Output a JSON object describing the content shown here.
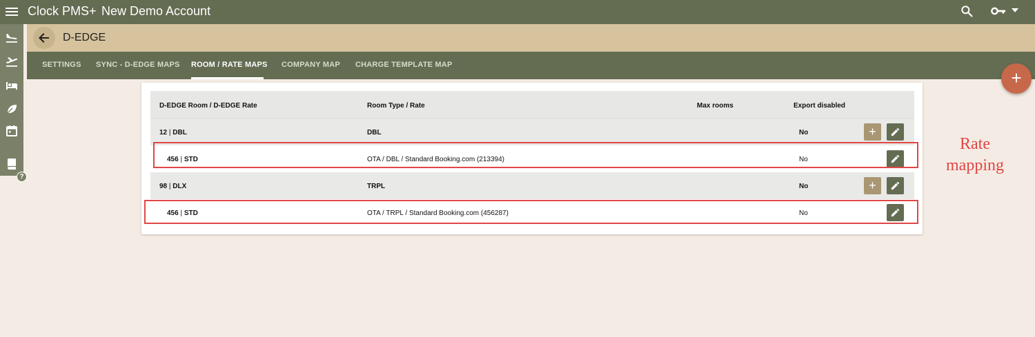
{
  "app": {
    "name": "Clock PMS+",
    "account": "New Demo Account"
  },
  "page": {
    "title": "D-EDGE"
  },
  "tabs": [
    {
      "label": "SETTINGS",
      "active": false
    },
    {
      "label": "SYNC - D-EDGE MAPS",
      "active": false
    },
    {
      "label": "ROOM / RATE MAPS",
      "active": true
    },
    {
      "label": "COMPANY MAP",
      "active": false
    },
    {
      "label": "CHARGE TEMPLATE MAP",
      "active": false
    }
  ],
  "table": {
    "columns": [
      "D-EDGE Room / D-EDGE Rate",
      "Room Type / Rate",
      "Max rooms",
      "Export disabled"
    ],
    "rows": [
      {
        "code": "12",
        "name": "DBL",
        "room_rate": "DBL",
        "max_rooms": "",
        "export_disabled": "No",
        "kind": "group"
      },
      {
        "code": "456",
        "name": "STD",
        "room_rate": "OTA / DBL / Standard Booking.com (213394)",
        "max_rooms": "",
        "export_disabled": "No",
        "kind": "child"
      },
      {
        "code": "98",
        "name": "DLX",
        "room_rate": "TRPL",
        "max_rooms": "",
        "export_disabled": "No",
        "kind": "group"
      },
      {
        "code": "456",
        "name": "STD",
        "room_rate": "OTA / TRPL / Standard Booking.com (456287)",
        "max_rooms": "",
        "export_disabled": "No",
        "kind": "child"
      }
    ],
    "separator": "|"
  },
  "annotation": {
    "line1": "Rate",
    "line2": "mapping",
    "color": "#e04646"
  },
  "help": {
    "label": "?"
  },
  "fab": {
    "label": "+"
  },
  "add_label": "+",
  "icons": {
    "menu": "hamburger-icon",
    "search": "search-icon",
    "key": "key-icon",
    "account_menu": "chevron-down-icon",
    "back": "arrow-left-icon",
    "side": [
      "flight-land-icon",
      "flight-takeoff-icon",
      "bed-icon",
      "leaf-icon",
      "calendar-icon",
      "book-icon"
    ],
    "edit": "pencil-icon",
    "add": "plus-icon"
  },
  "colors": {
    "topbar": "#646c52",
    "titlebar": "#d6c39e",
    "fab": "#c8684a",
    "add_button": "#a89772",
    "edit_button": "#646c52"
  }
}
